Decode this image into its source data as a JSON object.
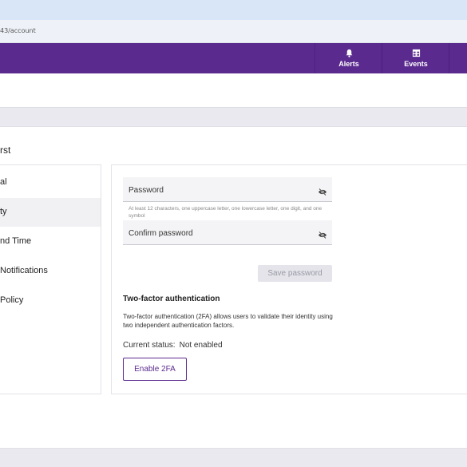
{
  "browser": {
    "url": "43/account"
  },
  "navbar": {
    "buttons": [
      {
        "label": "Alerts",
        "icon": "bell-icon"
      },
      {
        "label": "Events",
        "icon": "table-icon"
      }
    ],
    "color": "#5b2a8e"
  },
  "profile": {
    "name_fragment": "rst"
  },
  "sidebar": {
    "items": [
      {
        "label": "al"
      },
      {
        "label": "ty",
        "active": true
      },
      {
        "label": "nd Time"
      },
      {
        "label": "Notifications"
      },
      {
        "label": "Policy"
      }
    ]
  },
  "password": {
    "password_label": "Password",
    "hint": "At least 12 characters, one uppercase letter, one lowercase letter, one digit, and one symbol",
    "confirm_label": "Confirm password",
    "save_label": "Save password"
  },
  "two_factor": {
    "title": "Two-factor authentication",
    "description": "Two-factor authentication (2FA) allows users to validate their identity using two independent authentication factors.",
    "status_label": "Current status:",
    "status_value": "Not enabled",
    "enable_label": "Enable 2FA"
  }
}
